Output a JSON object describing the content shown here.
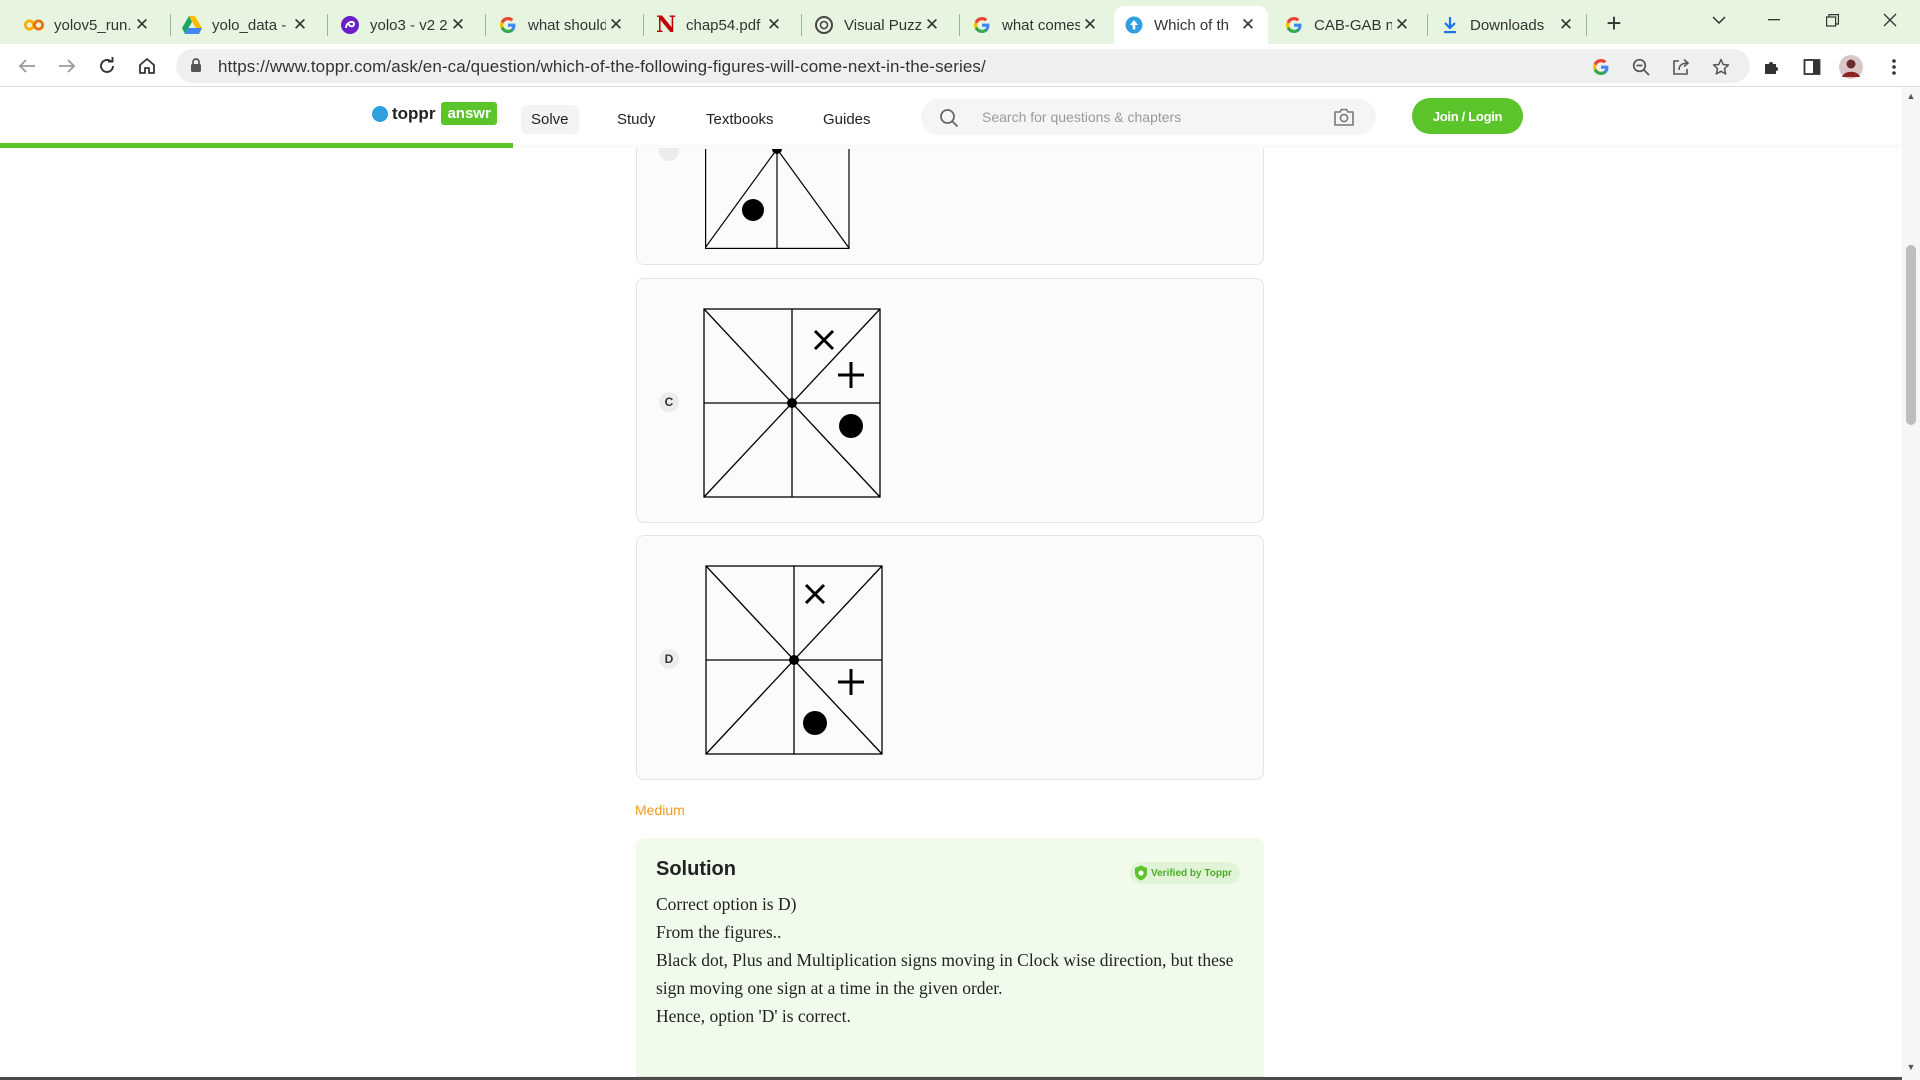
{
  "browser": {
    "tabs": [
      {
        "title": "yolov5_run..",
        "icon": "colab-icon",
        "active": false
      },
      {
        "title": "yolo_data -",
        "icon": "google-drive-icon",
        "active": false
      },
      {
        "title": "yolo3 - v2 2",
        "icon": "roboflow-icon",
        "active": false
      },
      {
        "title": "what should",
        "icon": "google-icon",
        "active": false
      },
      {
        "title": "chap54.pdf",
        "icon": "netflix-n-icon",
        "active": false
      },
      {
        "title": "Visual Puzzl",
        "icon": "openai-icon",
        "active": false
      },
      {
        "title": "what comes",
        "icon": "google-icon",
        "active": false
      },
      {
        "title": "Which of th",
        "icon": "toppr-icon",
        "active": true
      },
      {
        "title": "CAB-GAB n",
        "icon": "google-icon",
        "active": false
      },
      {
        "title": "Downloads",
        "icon": "download-icon",
        "active": false
      }
    ],
    "url": "https://www.toppr.com/ask/en-ca/question/which-of-the-following-figures-will-come-next-in-the-series/"
  },
  "site": {
    "brand": "toppr",
    "brand_tag": "answr",
    "nav": [
      {
        "label": "Solve",
        "active": true
      },
      {
        "label": "Study",
        "active": false
      },
      {
        "label": "Textbooks",
        "active": false
      },
      {
        "label": "Guides",
        "active": false
      }
    ],
    "search_placeholder": "Search for questions & chapters",
    "join_label": "Join / Login",
    "accent": "#5ac42a"
  },
  "options": [
    {
      "letter": "C"
    },
    {
      "letter": "D"
    }
  ],
  "difficulty": "Medium",
  "solution": {
    "title": "Solution",
    "verified": "Verified by Toppr",
    "lines": [
      "Correct option is D)",
      "From the figures..",
      "Black dot, Plus and Multiplication signs moving in Clock wise direction, but these sign moving one sign at a time in the given order.",
      "Hence, option 'D' is correct."
    ]
  }
}
